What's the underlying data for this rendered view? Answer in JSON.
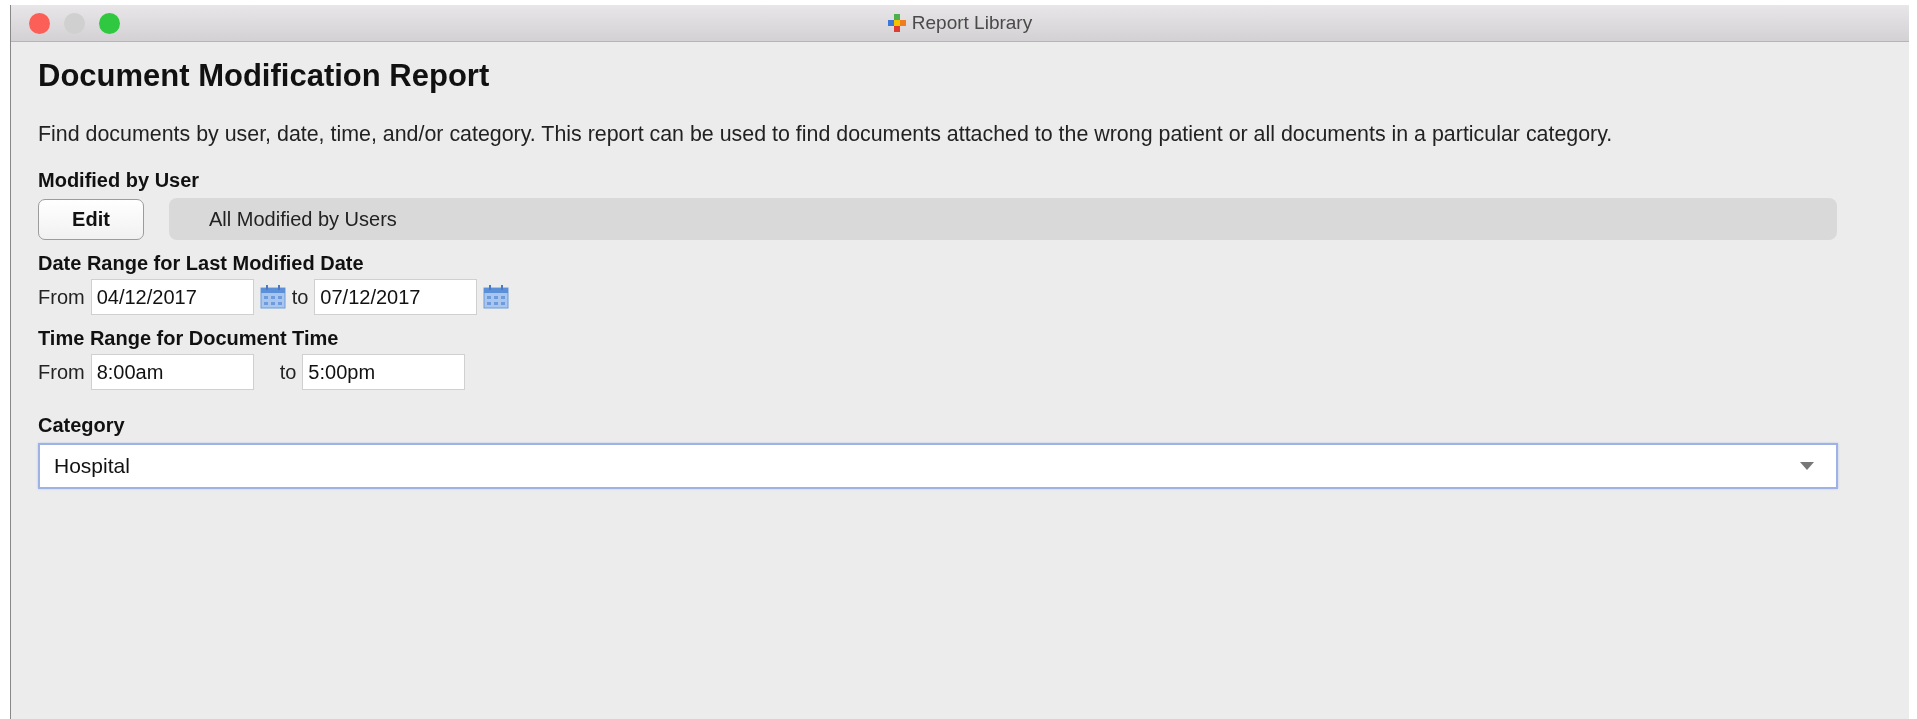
{
  "window": {
    "title": "Report Library"
  },
  "heading": "Document Modification Report",
  "description": "Find documents by user, date, time, and/or category. This report can be used to find documents attached to the wrong patient or all documents in a particular category.",
  "modified_by_user": {
    "label": "Modified by User",
    "button": "Edit",
    "value": "All Modified by Users"
  },
  "date_range": {
    "label": "Date Range for Last Modified Date",
    "from_label": "From",
    "from": "04/12/2017",
    "to_label": "to",
    "to": "07/12/2017"
  },
  "time_range": {
    "label": "Time Range for Document Time",
    "from_label": "From",
    "from": "8:00am",
    "to_label": "to",
    "to": "5:00pm"
  },
  "category": {
    "label": "Category",
    "value": "Hospital",
    "focused": true
  }
}
